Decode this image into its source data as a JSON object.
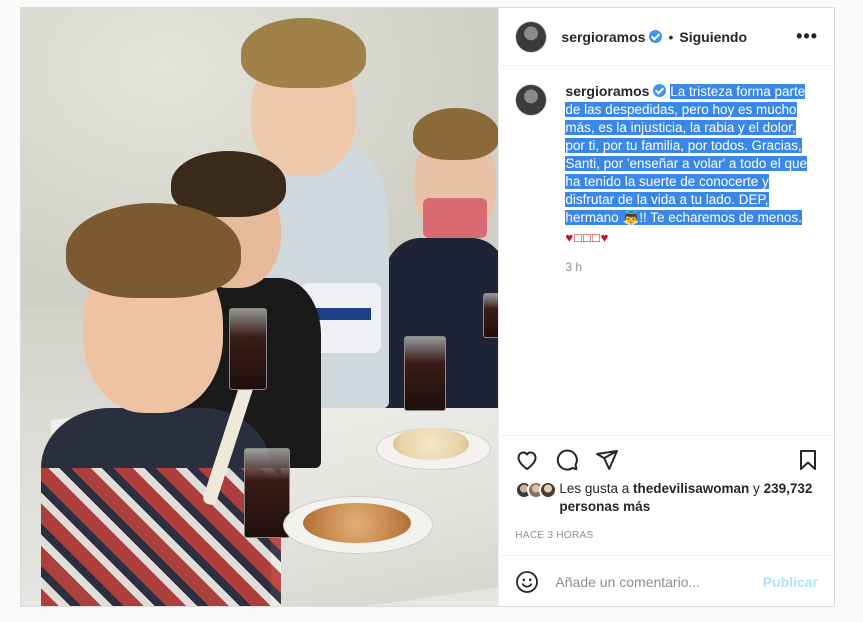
{
  "post": {
    "author": {
      "username": "sergioramos",
      "verified": true
    },
    "separator": "•",
    "follow_status": "Siguiendo",
    "options_icon": "more-horizontal-icon",
    "caption": {
      "username": "sergioramos",
      "text": "La tristeza forma parte de las despedidas, pero hoy es mucho más, es la injusticia, la rabia y el dolor, por ti, por tu familia, por todos. Gracias, Santi, por 'enseñar a volar' a todo el que ha tenido la suerte de conocerte y disfrutar de la vida a tu lado. DEP, hermano 👼!! Te echaremos de menos.",
      "emoji_line": "♥□□□♥",
      "time": "3 h"
    },
    "actions": {
      "like_icon": "heart-icon",
      "comment_icon": "comment-icon",
      "share_icon": "send-icon",
      "save_icon": "bookmark-icon"
    },
    "likes": {
      "prefix": "Les gusta a",
      "user": "thedevilisawoman",
      "connector": "y",
      "count": "239,732 personas más"
    },
    "posted_ago": "HACE 3 HORAS",
    "comment": {
      "placeholder": "Añade un comentario...",
      "publish_label": "Publicar",
      "emoji_icon": "smiley-icon"
    }
  },
  "colors": {
    "selection": "#3b87e6",
    "verified": "#3897f0",
    "publish_disabled": "#b2dffc",
    "heart_red": "#c8102e"
  }
}
